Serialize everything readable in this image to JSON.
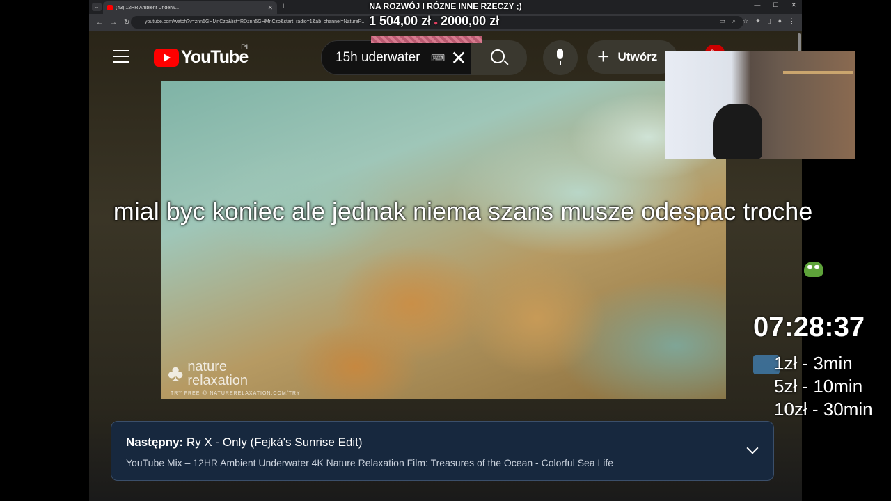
{
  "stream": {
    "goal_title": "NA ROZWÓJ I RÓZNE INNE RZECZY ;)",
    "goal_current": "1 504,00 zł",
    "goal_target": "2000,00 zł",
    "caption": "mial byc koniec ale jednak niema szans musze odespac troche",
    "timer": "07:28:37",
    "prices": [
      "1zł - 3min",
      "5zł - 10min",
      "10zł - 30min"
    ]
  },
  "browser": {
    "tab_title": "(43) 12HR Ambient Underw...",
    "url": "youtube.com/watch?v=znn5GHMnCzo&list=RDznn5GHMnCzo&start_radio=1&ab_channel=NatureR..."
  },
  "youtube": {
    "logo_text": "YouTube",
    "region": "PL",
    "search_value": "15h uderwater",
    "create_label": "Utwórz",
    "notifications": "9+"
  },
  "video": {
    "watermark_line1": "nature",
    "watermark_line2": "relaxation",
    "watermark_sub": "TRY FREE @ NATURERELAXATION.COM/TRY"
  },
  "up_next": {
    "prefix": "Następny:",
    "title": "Ry X - Only (Fejká's Sunrise Edit)",
    "subtitle": "YouTube Mix – 12HR Ambient Underwater 4K Nature Relaxation Film: Treasures of the Ocean - Colorful Sea Life"
  },
  "colors": {
    "youtube_red": "#ff0000",
    "upnext_bg": "#17283e"
  }
}
